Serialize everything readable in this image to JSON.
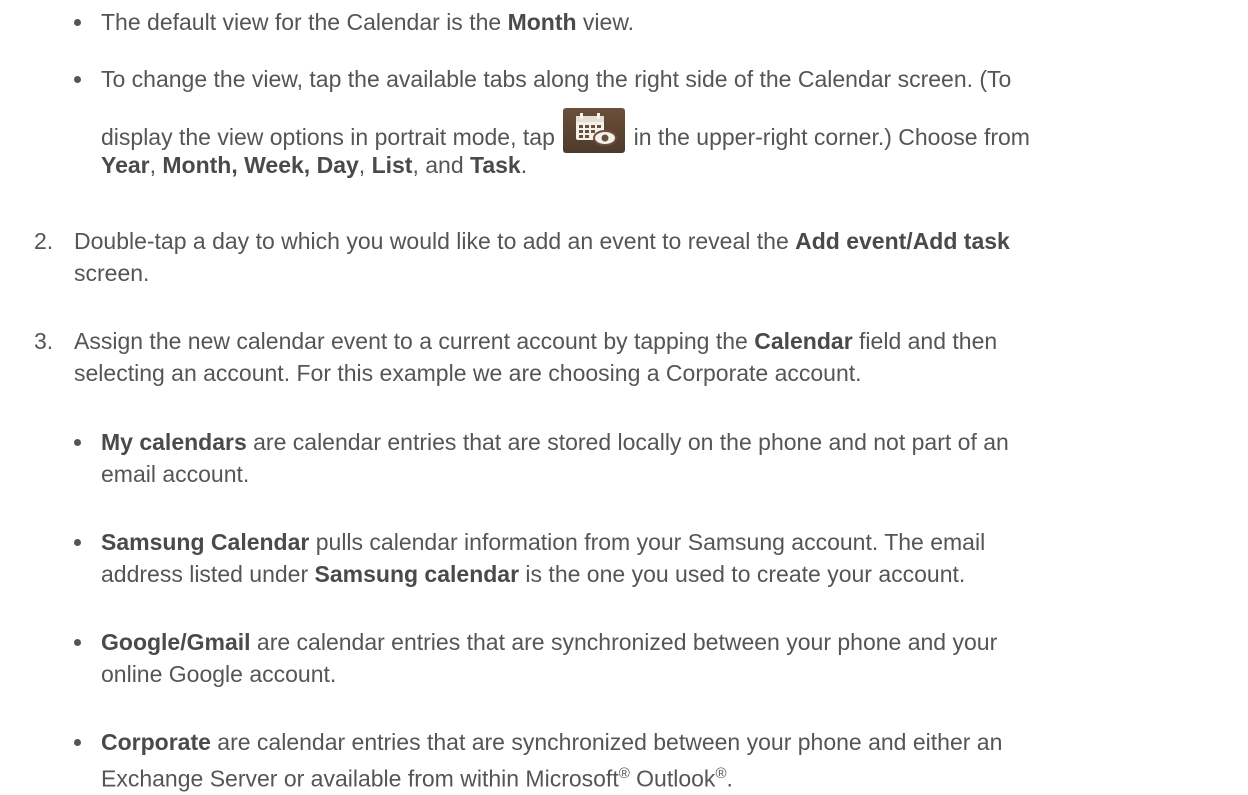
{
  "bullets_top": [
    {
      "pre": "The default view for the Calendar is the ",
      "bold": "Month",
      "post": " view."
    },
    {
      "line1": "To change the view, tap the available tabs along the right side of the Calendar screen. (To",
      "line2_pre": "display the view options in portrait mode, tap ",
      "icon": "calendar-view-icon",
      "line2_post": " in the upper-right corner.) Choose from",
      "year": "Year",
      "sep1": ", ",
      "mwd": "Month, Week, Day",
      "sep2": ", ",
      "list": "List",
      "sep3": ", and ",
      "task": "Task",
      "end": "."
    }
  ],
  "steps": [
    {
      "num": "2.",
      "pre": "Double-tap a day to which you would like to add an event to reveal the ",
      "bold": "Add event/Add task",
      "post": "screen."
    },
    {
      "num": "3.",
      "pre": "Assign the new calendar event to a current account by tapping the ",
      "bold": "Calendar",
      "mid": " field and then",
      "line2": "selecting an account. For this example we are choosing a Corporate account."
    }
  ],
  "bullets_bottom": [
    {
      "bold": "My calendars",
      "text1": " are calendar entries that are stored locally on the phone and not part of an",
      "text2": "email account."
    },
    {
      "bold": "Samsung Calendar",
      "text1": " pulls calendar information from your Samsung account. The email",
      "text2_pre": "address listed under ",
      "bold2": "Samsung calendar",
      "text2_post": " is the one you used to create your account."
    },
    {
      "bold": "Google/Gmail",
      "text1": " are calendar entries that are synchronized between your phone and your",
      "text2": "online Google account."
    },
    {
      "bold": "Corporate",
      "text1": " are calendar entries that are synchronized between your phone and either an",
      "text2_pre": "Exchange Server or available from within Microsoft",
      "reg1": "®",
      "text2_mid": " Outlook",
      "reg2": "®",
      "text2_end": "."
    }
  ]
}
